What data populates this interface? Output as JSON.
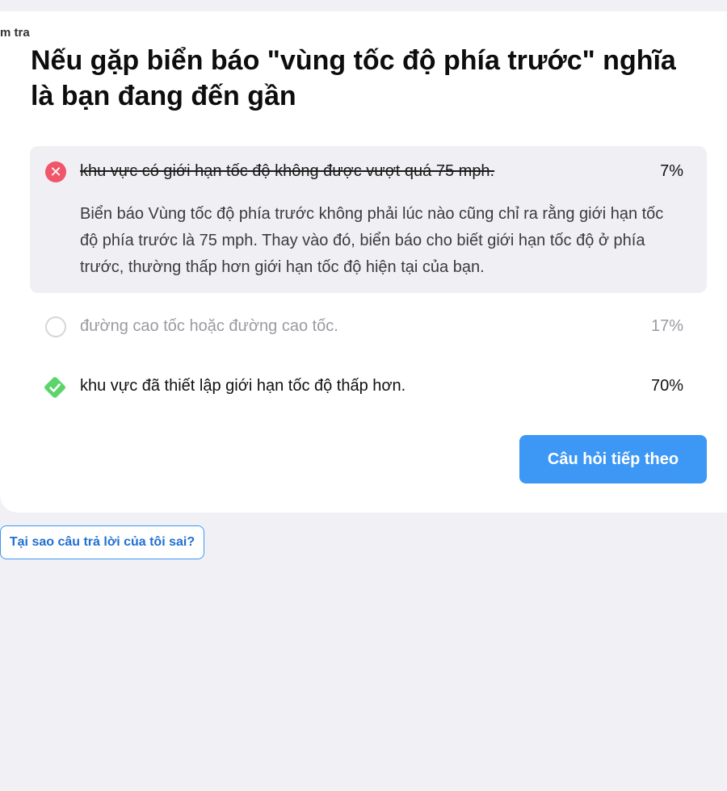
{
  "quiz": {
    "clipped_label": "m tra",
    "question": "Nếu gặp biển báo \"vùng tốc độ phía trước\" nghĩa là bạn đang đến gần",
    "answers": [
      {
        "text": "khu vực có giới hạn tốc độ không được vượt quá 75 mph.",
        "percent": "7%",
        "state": "wrong-selected",
        "explanation": "Biển báo Vùng tốc độ phía trước không phải lúc nào cũng chỉ ra rằng giới hạn tốc độ phía trước là 75 mph. Thay vào đó, biển báo cho biết giới hạn tốc độ ở phía trước, thường thấp hơn giới hạn tốc độ hiện tại của bạn."
      },
      {
        "text": "đường cao tốc hoặc đường cao tốc.",
        "percent": "17%",
        "state": "unselected"
      },
      {
        "text": "khu vực đã thiết lập giới hạn tốc độ thấp hơn.",
        "percent": "70%",
        "state": "correct"
      }
    ],
    "next_button": "Câu hỏi tiếp theo",
    "why_wrong_button": "Tại sao câu trả lời của tôi sai?"
  },
  "colors": {
    "wrong": "#f0566a",
    "correct": "#5bd46a",
    "primary": "#3c97f5"
  },
  "icons": [
    "close-icon",
    "radio-empty-icon",
    "check-diamond-icon"
  ]
}
